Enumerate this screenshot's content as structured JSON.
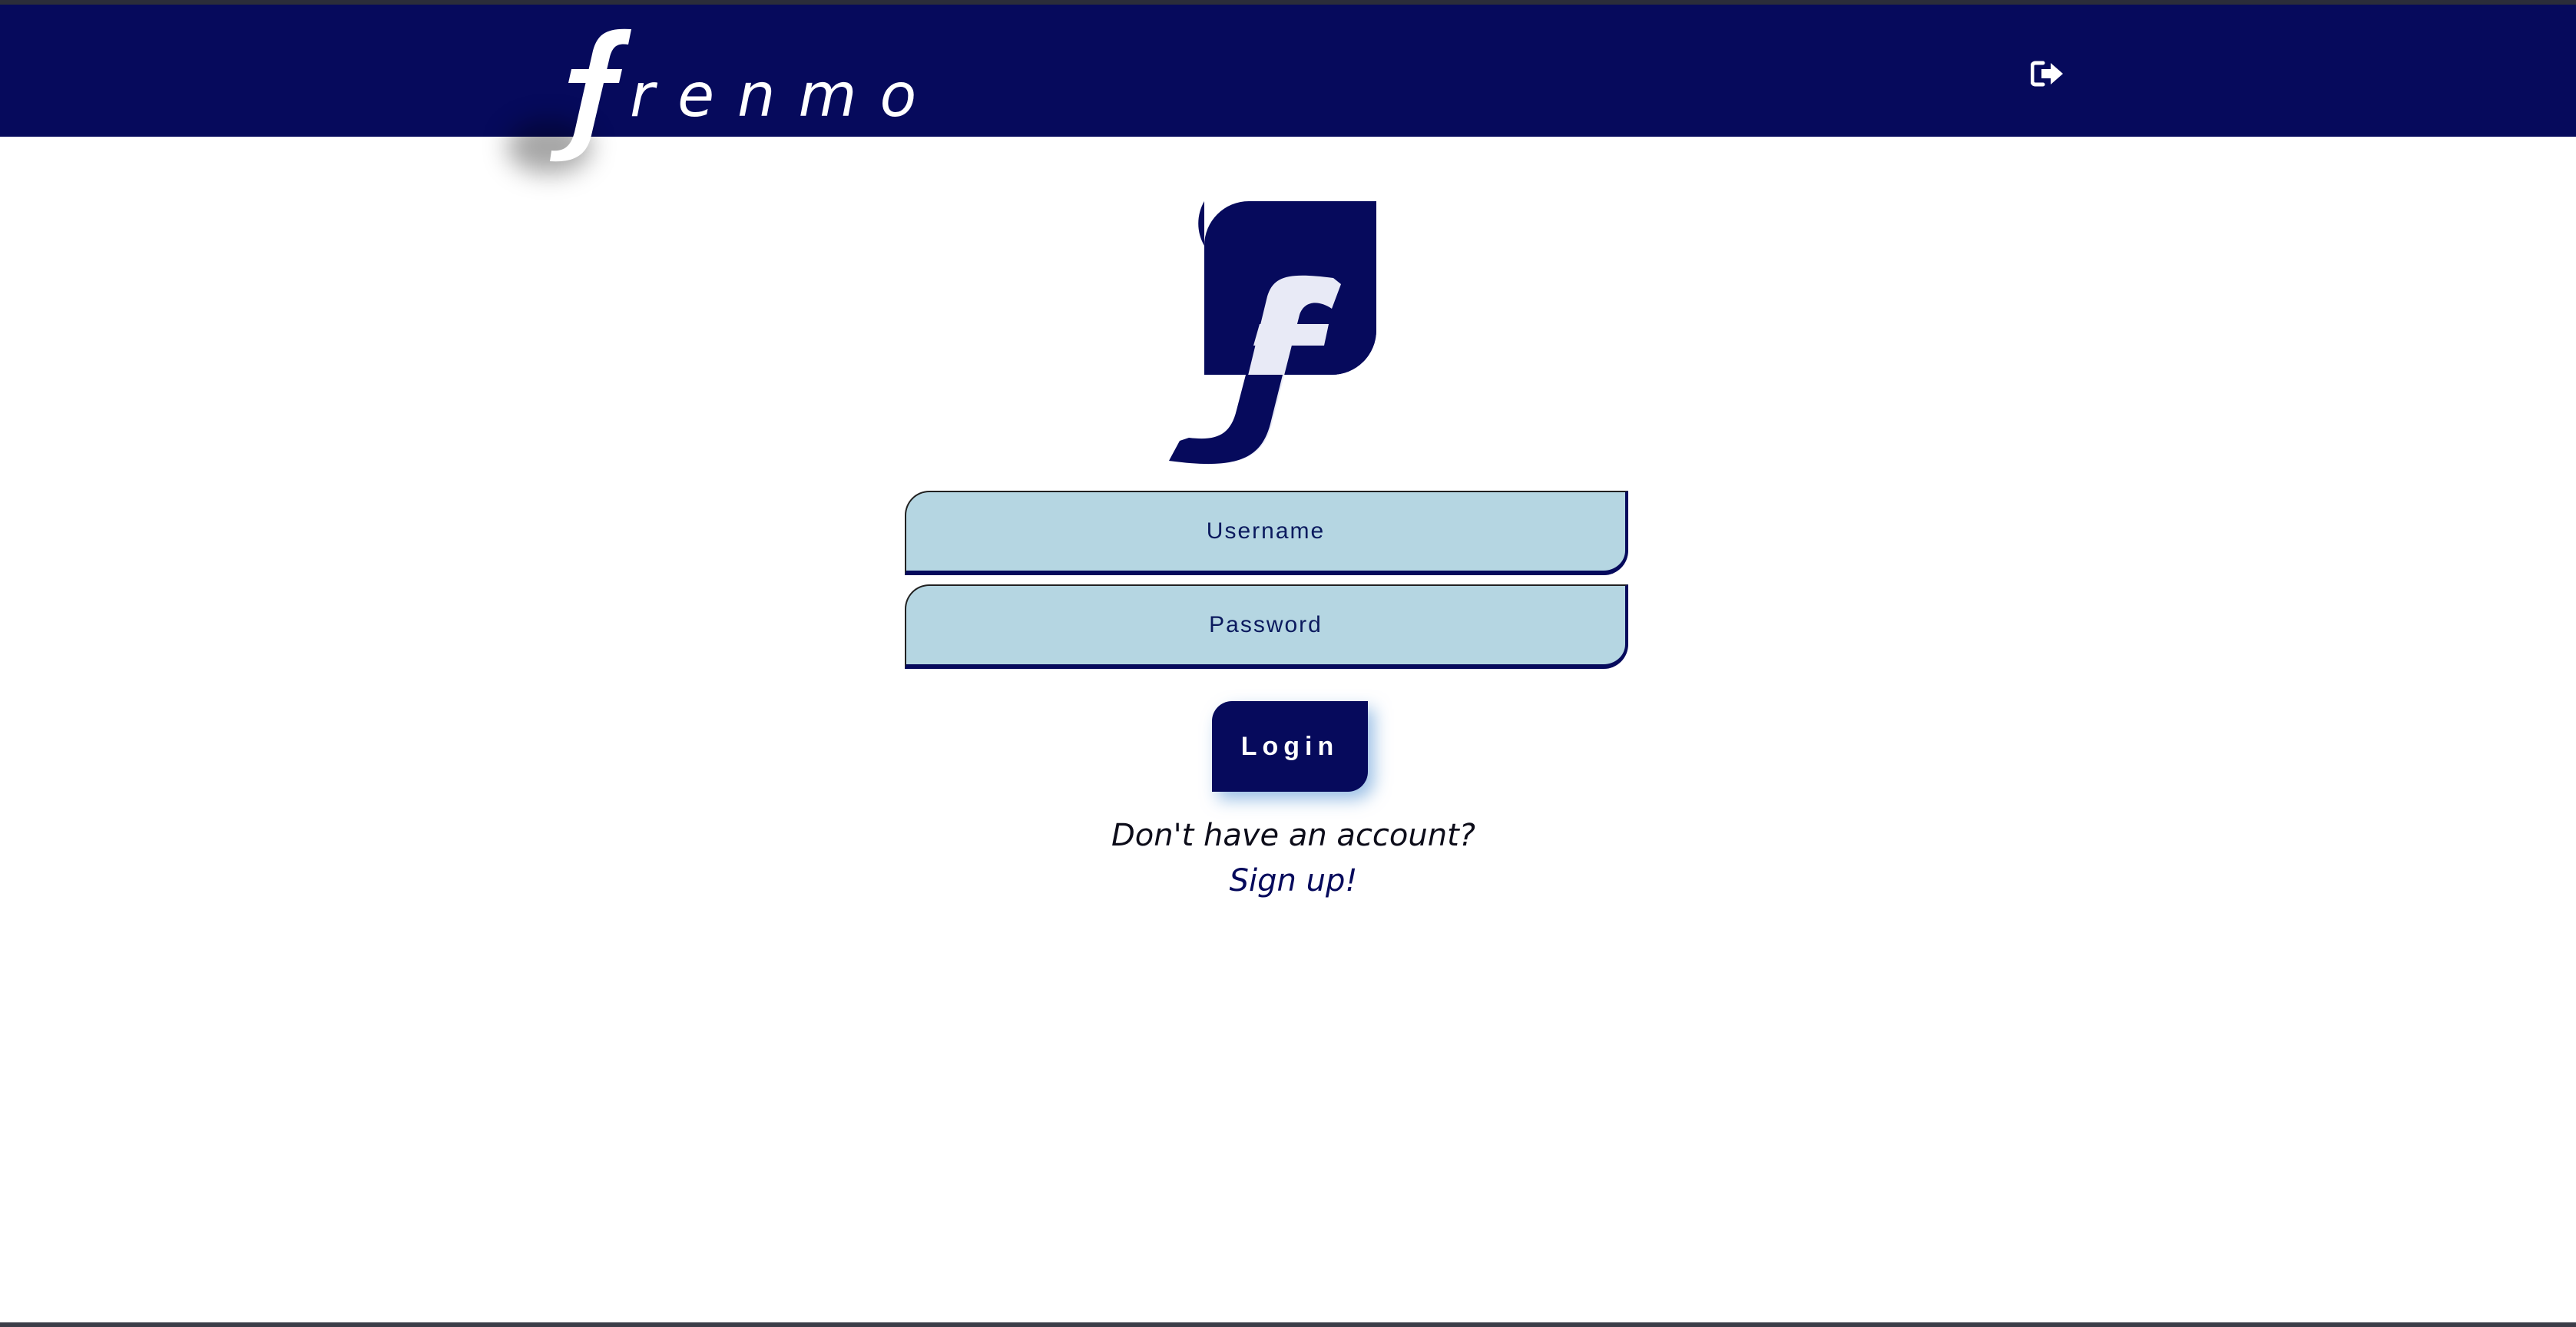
{
  "header": {
    "brand_text": "renmo",
    "logout_icon": "sign-out-icon"
  },
  "logo": {
    "icon": "frenmo-f-logo"
  },
  "form": {
    "username_placeholder": "Username",
    "password_placeholder": "Password",
    "login_label": "Login"
  },
  "signup": {
    "prompt": "Don't have an account?",
    "link_label": "Sign up!"
  },
  "colors": {
    "navy": "#060a5c",
    "field_bg": "#b5d6e2",
    "white": "#ffffff"
  }
}
